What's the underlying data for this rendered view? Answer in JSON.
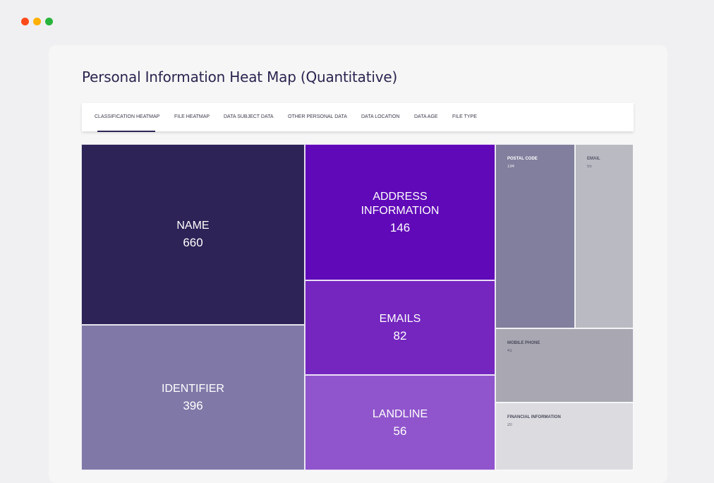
{
  "window": {
    "controls": [
      {
        "name": "close",
        "color": "#ff4a1c"
      },
      {
        "name": "minimize",
        "color": "#ffb000"
      },
      {
        "name": "maximize",
        "color": "#27b43c"
      }
    ]
  },
  "header": {
    "title": "Personal Information Heat Map (Quantitative)"
  },
  "tabs": [
    {
      "label": "CLASSIFICATION HEATMAP",
      "active": true
    },
    {
      "label": "FILE HEATMAP",
      "active": false
    },
    {
      "label": "DATA SUBJECT DATA",
      "active": false
    },
    {
      "label": "OTHER PERSONAL DATA",
      "active": false
    },
    {
      "label": "DATA LOCATION",
      "active": false
    },
    {
      "label": "DATA AGE",
      "active": false
    },
    {
      "label": "FILE TYPE",
      "active": false
    }
  ],
  "colors": {
    "accent": "#2f2756",
    "name": "#2d2357",
    "identifier": "#8079a8",
    "address": "#6009b8",
    "emails": "#7426bf",
    "landline": "#9055cc",
    "postal_code": "#817f9d",
    "email": "#babac2",
    "mobile_phone": "#a8a7b2",
    "financial": "#dcdce0"
  },
  "chart_data": {
    "type": "treemap",
    "title": "Personal Information Heat Map (Quantitative)",
    "items": [
      {
        "label": "NAME",
        "label_lines": [
          "NAME"
        ],
        "value": 660
      },
      {
        "label": "IDENTIFIER",
        "label_lines": [
          "IDENTIFIER"
        ],
        "value": 396
      },
      {
        "label": "ADDRESS INFORMATION",
        "label_lines": [
          "ADDRESS",
          "INFORMATION"
        ],
        "value": 146
      },
      {
        "label": "EMAILS",
        "label_lines": [
          "EMAILS"
        ],
        "value": 82
      },
      {
        "label": "LANDLINE",
        "label_lines": [
          "LANDLINE"
        ],
        "value": 56
      },
      {
        "label": "POSTAL CODE",
        "label_lines": [
          "POSTAL CODE"
        ],
        "value": 194
      },
      {
        "label": "EMAIL",
        "label_lines": [
          "EMAIL"
        ],
        "value": 55
      },
      {
        "label": "MOBILE PHONE",
        "label_lines": [
          "MOBILE PHONE"
        ],
        "value": 41
      },
      {
        "label": "FINANCIAL INFORMATION",
        "label_lines": [
          "FINANCIAL INFORMATION"
        ],
        "value": 20
      }
    ]
  }
}
